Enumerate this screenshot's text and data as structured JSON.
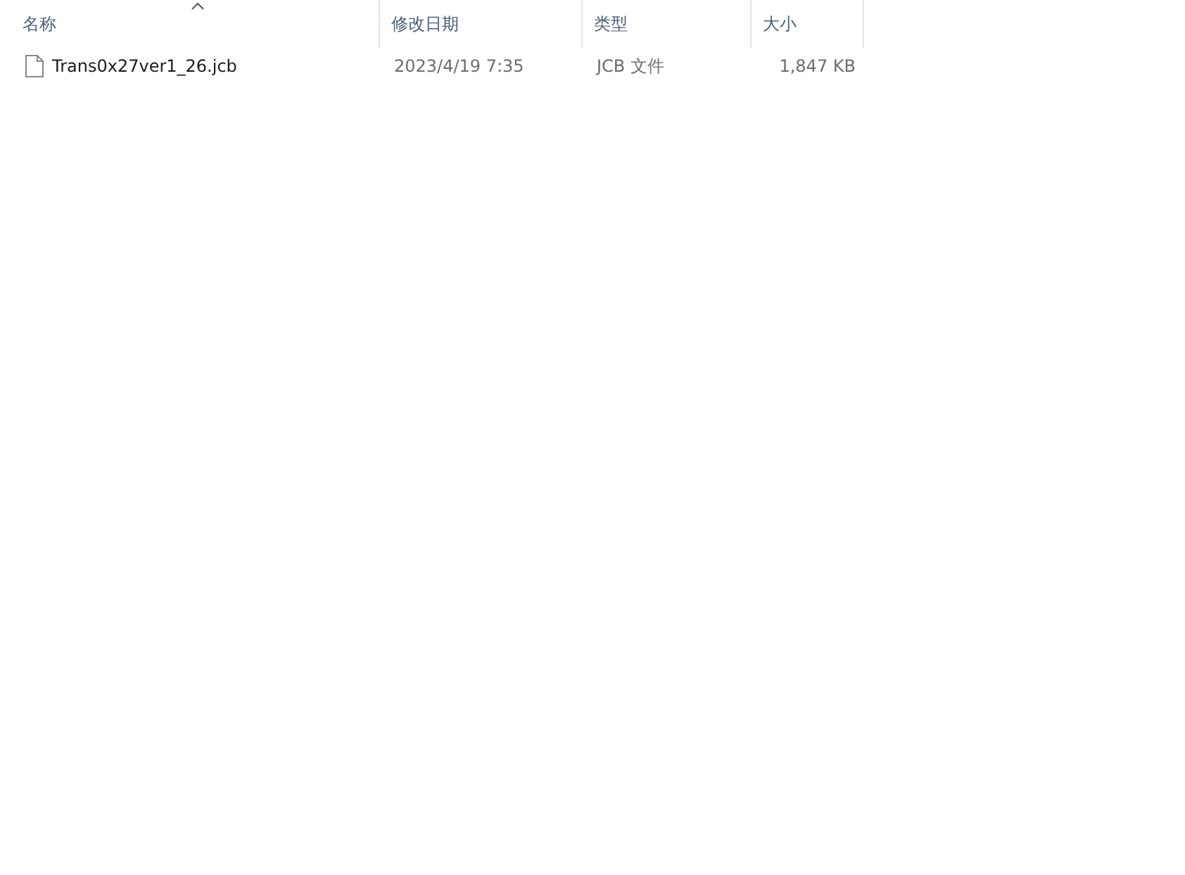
{
  "table": {
    "columns": [
      {
        "label": "名称",
        "sorted": true
      },
      {
        "label": "修改日期",
        "sorted": false
      },
      {
        "label": "类型",
        "sorted": false
      },
      {
        "label": "大小",
        "sorted": false
      }
    ],
    "rows": [
      {
        "cells": [
          "Trans0x27ver1_26.jcb",
          "2023/4/19 7:35",
          "JCB 文件",
          "1,847 KB"
        ]
      }
    ]
  }
}
